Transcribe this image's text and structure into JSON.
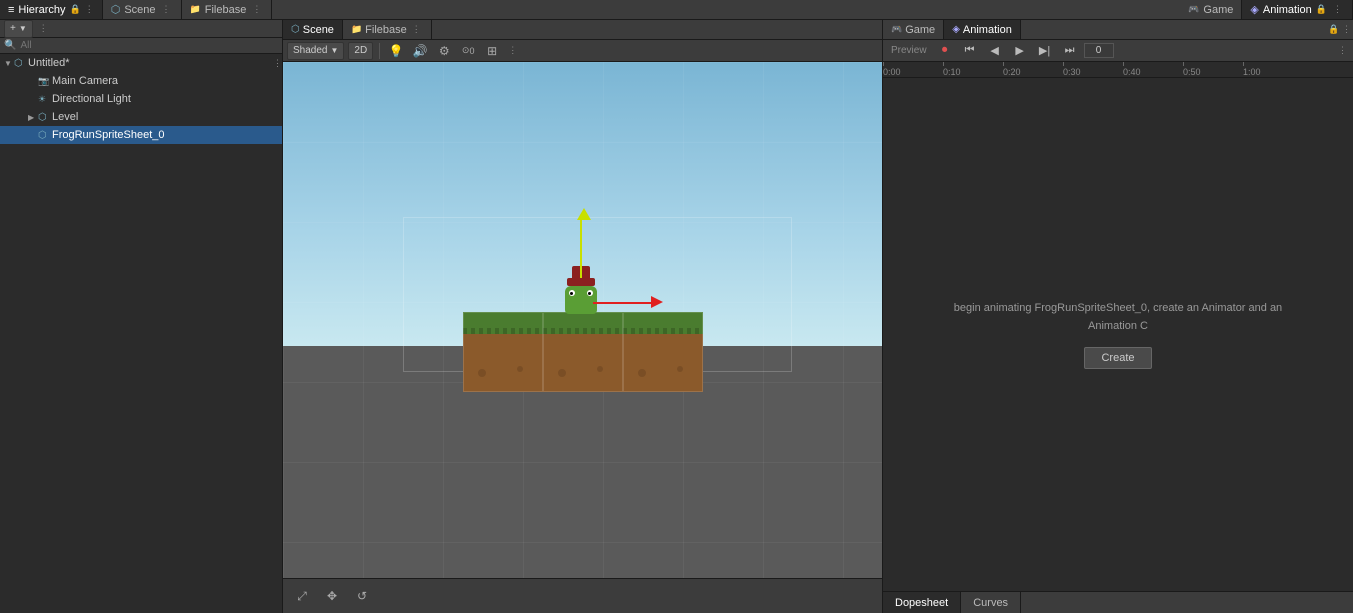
{
  "topBar": {
    "tabs": [
      {
        "id": "hierarchy",
        "label": "Hierarchy",
        "active": true,
        "icon": "≡",
        "hasLock": true,
        "hasMenu": true
      },
      {
        "id": "scene",
        "label": "Scene",
        "active": false,
        "icon": "⬡"
      },
      {
        "id": "filebase",
        "label": "Filebase",
        "active": false,
        "icon": "📁"
      },
      {
        "id": "game",
        "label": "Game",
        "active": false,
        "icon": "🎮"
      },
      {
        "id": "animation",
        "label": "Animation",
        "active": false,
        "icon": "◈"
      }
    ]
  },
  "hierarchy": {
    "searchPlaceholder": "All",
    "items": [
      {
        "id": "untitled",
        "label": "Untitled*",
        "level": 0,
        "hasArrow": true,
        "arrowDown": true,
        "icon": "⬡",
        "asterisk": true
      },
      {
        "id": "mainCamera",
        "label": "Main Camera",
        "level": 1,
        "hasArrow": false,
        "icon": "📷"
      },
      {
        "id": "directionalLight",
        "label": "Directional Light",
        "level": 1,
        "hasArrow": false,
        "icon": "☀"
      },
      {
        "id": "level",
        "label": "Level",
        "level": 1,
        "hasArrow": true,
        "arrowRight": true,
        "icon": "⬡"
      },
      {
        "id": "frogRunSpriteSheet",
        "label": "FrogRunSpriteSheet_0",
        "level": 1,
        "hasArrow": false,
        "icon": "⬡",
        "selected": true
      }
    ]
  },
  "sceneTabs": [
    {
      "id": "scene",
      "label": "Scene",
      "active": true,
      "icon": "⬡"
    },
    {
      "id": "filebase",
      "label": "Filebase",
      "active": false,
      "icon": "📁"
    }
  ],
  "sceneToolbar": {
    "shadingMode": "Shaded",
    "view2d": "2D",
    "icons": [
      "💡",
      "🔊",
      "⚙",
      "0",
      "⊞"
    ],
    "menuDots": "⋮"
  },
  "animationPanel": {
    "tabs": [
      {
        "id": "game",
        "label": "Game",
        "active": false,
        "icon": "🎮"
      },
      {
        "id": "animation",
        "label": "Animation",
        "active": true,
        "icon": "◈"
      }
    ],
    "toolbar": {
      "preview": "Preview",
      "transportButtons": [
        "⏺",
        "⏮",
        "⏴",
        "▶",
        "⏵",
        "⏭"
      ],
      "frameValue": "0",
      "menuDots": "⋮"
    },
    "ruler": {
      "ticks": [
        "0:00",
        "0:10",
        "0:20",
        "0:30",
        "0:40",
        "0:50",
        "1:00"
      ]
    },
    "message": "begin animating FrogRunSpriteSheet_0, create an Animator and an Animation C",
    "createButton": "Create",
    "bottomTabs": [
      {
        "id": "dopesheet",
        "label": "Dopesheet",
        "active": true
      },
      {
        "id": "curves",
        "label": "Curves",
        "active": false
      }
    ]
  },
  "animNavIcons": {
    "expand": "⤢",
    "move": "✥",
    "rotate": "↻"
  }
}
